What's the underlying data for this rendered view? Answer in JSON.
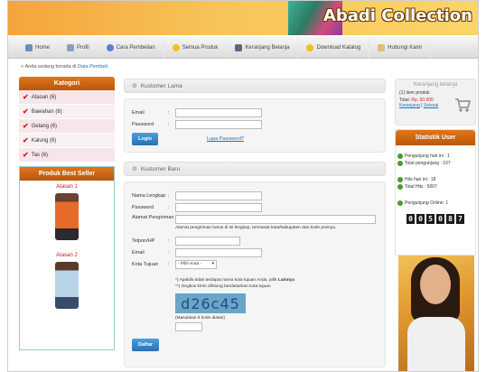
{
  "brand": "Abadi Collection",
  "nav": [
    {
      "label": "Home",
      "icon": "home-icon",
      "color": "#6b8fbf"
    },
    {
      "label": "Profil",
      "icon": "profile-icon",
      "color": "#8aa0b8"
    },
    {
      "label": "Cara Pembelian",
      "icon": "help-icon",
      "color": "#5b7ed6"
    },
    {
      "label": "Semua Produk",
      "icon": "star-icon",
      "color": "#f2c020"
    },
    {
      "label": "Keranjang Belanja",
      "icon": "binoculars-icon",
      "color": "#5a6a80"
    },
    {
      "label": "Download Katalog",
      "icon": "star-icon",
      "color": "#f2c020"
    },
    {
      "label": "Hubungi Kami",
      "icon": "contact-icon",
      "color": "#e0c070"
    }
  ],
  "breadcrumb": {
    "prefix": "Anda sedang berada di",
    "link": "Data Pembeli"
  },
  "sidebar": {
    "kategori_title": "Kategori",
    "categories": [
      "Atasan (6)",
      "Bawahan (6)",
      "Gelang (6)",
      "Kalung (6)",
      "Tas (6)"
    ],
    "best_title": "Produk Best Seller",
    "products": [
      {
        "name": "Atasan 1"
      },
      {
        "name": "Atasan 2"
      }
    ]
  },
  "kustomer_lama": {
    "title": "Kustomer Lama",
    "email_label": "Email",
    "password_label": "Password",
    "login_label": "Login",
    "lupa_label": "Lupa Password?"
  },
  "kustomer_baru": {
    "title": "Kustomer Baru",
    "nama_label": "Nama Lengkap",
    "password_label": "Password",
    "alamat_label": "Alamat Pengiriman",
    "alamat_hint": "Alamat pengiriman harus di isi lengkap, termasuk kota/kabupaten dan kode posnya.",
    "telpon_label": "Telpon/HP",
    "email_label": "Email",
    "kota_label": "Kota Tujuan",
    "kota_selected": "- Pilih Kota -",
    "note1_prefix": "*) Apabila tidak terdapat nama kota tujuan Anda, pilih",
    "note1_bold": "Lainnya",
    "note2": "**) Ongkos kirim dihitung berdasarkan kota tujuan",
    "captcha": "d26c45",
    "captcha_hint": "(Masukkan 6 kode diatas)",
    "daftar_label": "Daftar"
  },
  "cart": {
    "title": "Keranjang belanja",
    "items": "(1) item produk",
    "total_label": "Total:",
    "total_value": "Rp. 50.000",
    "link1": "Keranjang",
    "separator": "|",
    "link2": "Selesai"
  },
  "stats": {
    "title": "Statistik User",
    "lines": [
      "Pengunjung hari ini : 1",
      "Total pengunjung : 107",
      "Hits hari ini : 18",
      "Total Hits : 5007",
      "Pengunjung Online: 1"
    ],
    "counter": [
      "0",
      "0",
      "5",
      "0",
      "8",
      "7"
    ]
  }
}
